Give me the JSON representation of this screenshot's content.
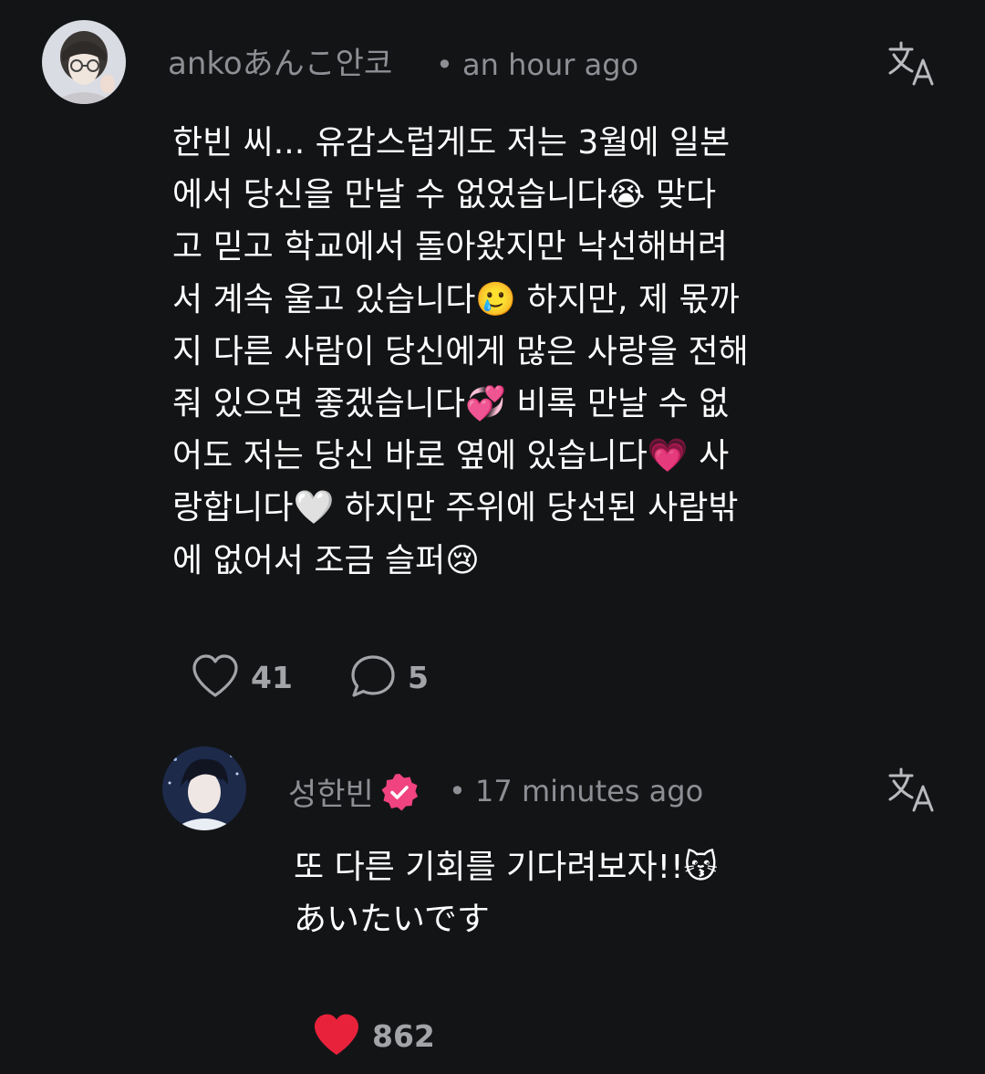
{
  "comment": {
    "username": "ankoあんこ안코",
    "time": "• an hour ago",
    "lines": [
      "한빈 씨... 유감스럽게도 저는 3월에 일본",
      "에서 당신을 만날 수 없었습니다😭 맞다",
      "고 믿고 학교에서 돌아왔지만 낙선해버려",
      "서 계속 울고 있습니다🥲 하지만, 제 몫까",
      "지 다른 사람이 당신에게 많은 사랑을 전해",
      "줘 있으면 좋겠습니다💞 비록 만날 수 없",
      "어도 저는 당신 바로 옆에 있습니다💗 사",
      "랑합니다🤍 하지만 주위에 당선된 사람밖",
      "에 없어서 조금 슬퍼😢"
    ],
    "like_count": "41",
    "reply_count": "5",
    "icons": {
      "avatar": "avatar-photo",
      "translate": "translate-icon",
      "like": "heart-outline-icon",
      "reply": "speech-bubble-icon"
    }
  },
  "reply": {
    "username": "성한빈",
    "time": "• 17 minutes ago",
    "lines": [
      "또 다른 기회를 기다려보자!!😽",
      "あいたいです"
    ],
    "like_count": "862",
    "icons": {
      "avatar": "avatar-photo",
      "verified": "verified-badge-icon",
      "translate": "translate-icon",
      "like": "heart-filled-icon"
    }
  },
  "colors": {
    "background": "#131416",
    "text": "#ffffff",
    "muted": "#8d8f94",
    "verified_badge": "#f0437f",
    "heart_filled": "#e8223b"
  }
}
